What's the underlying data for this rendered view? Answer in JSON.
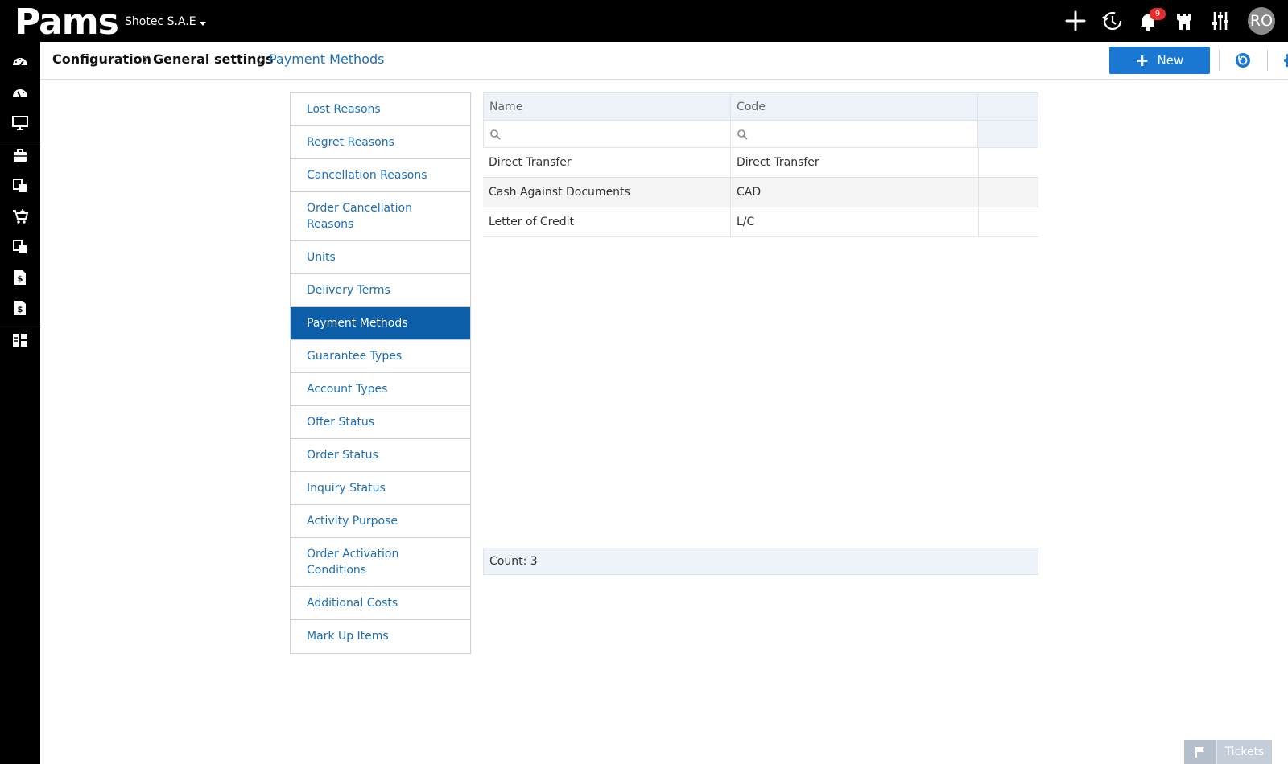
{
  "app": {
    "logo_text": "Pams",
    "company": "Shotec S.A.E",
    "notifications_count": "9",
    "user_initials": "RO"
  },
  "topbar_icons": [
    "plus-icon",
    "history-icon",
    "bell-icon",
    "castle-icon",
    "sliders-icon"
  ],
  "sidebar_icons": [
    "dashboard-icon",
    "speedometer-icon",
    "monitor-icon",
    "briefcase-icon",
    "documents-icon",
    "cart-icon",
    "documents-icon",
    "invoice-dollar-icon",
    "invoice-dollar-icon",
    "layout-grid-icon"
  ],
  "breadcrumb": {
    "level1": "Configuration",
    "level2": "General settings",
    "current": "Payment Methods"
  },
  "toolbar": {
    "new_label": "New",
    "refresh_icon": "refresh-icon",
    "settings_icon": "gear-icon"
  },
  "settings_list": {
    "items": [
      {
        "label": "Lost Reasons"
      },
      {
        "label": "Regret Reasons"
      },
      {
        "label": "Cancellation Reasons"
      },
      {
        "label": "Order Cancellation Reasons"
      },
      {
        "label": "Units"
      },
      {
        "label": "Delivery Terms"
      },
      {
        "label": "Payment Methods"
      },
      {
        "label": "Guarantee Types"
      },
      {
        "label": "Account Types"
      },
      {
        "label": "Offer Status"
      },
      {
        "label": "Order Status"
      },
      {
        "label": "Inquiry Status"
      },
      {
        "label": "Activity Purpose"
      },
      {
        "label": "Order Activation Conditions"
      },
      {
        "label": "Additional Costs"
      },
      {
        "label": "Mark Up Items"
      }
    ],
    "selected": "Payment Methods"
  },
  "grid": {
    "columns": [
      "Name",
      "Code",
      ""
    ],
    "rows": [
      {
        "name": "Direct Transfer",
        "code": "Direct Transfer"
      },
      {
        "name": "Cash Against Documents",
        "code": "CAD"
      },
      {
        "name": "Letter of Credit",
        "code": "L/C"
      }
    ],
    "footer": "Count: 3"
  },
  "tickets": {
    "label": "Tickets",
    "icon": "flag-icon"
  },
  "colors": {
    "topbar": "#000000",
    "accent": "#1a78d2",
    "selected": "#0c5ea8",
    "link": "#1d6fb8",
    "badge": "#e52d2d"
  }
}
